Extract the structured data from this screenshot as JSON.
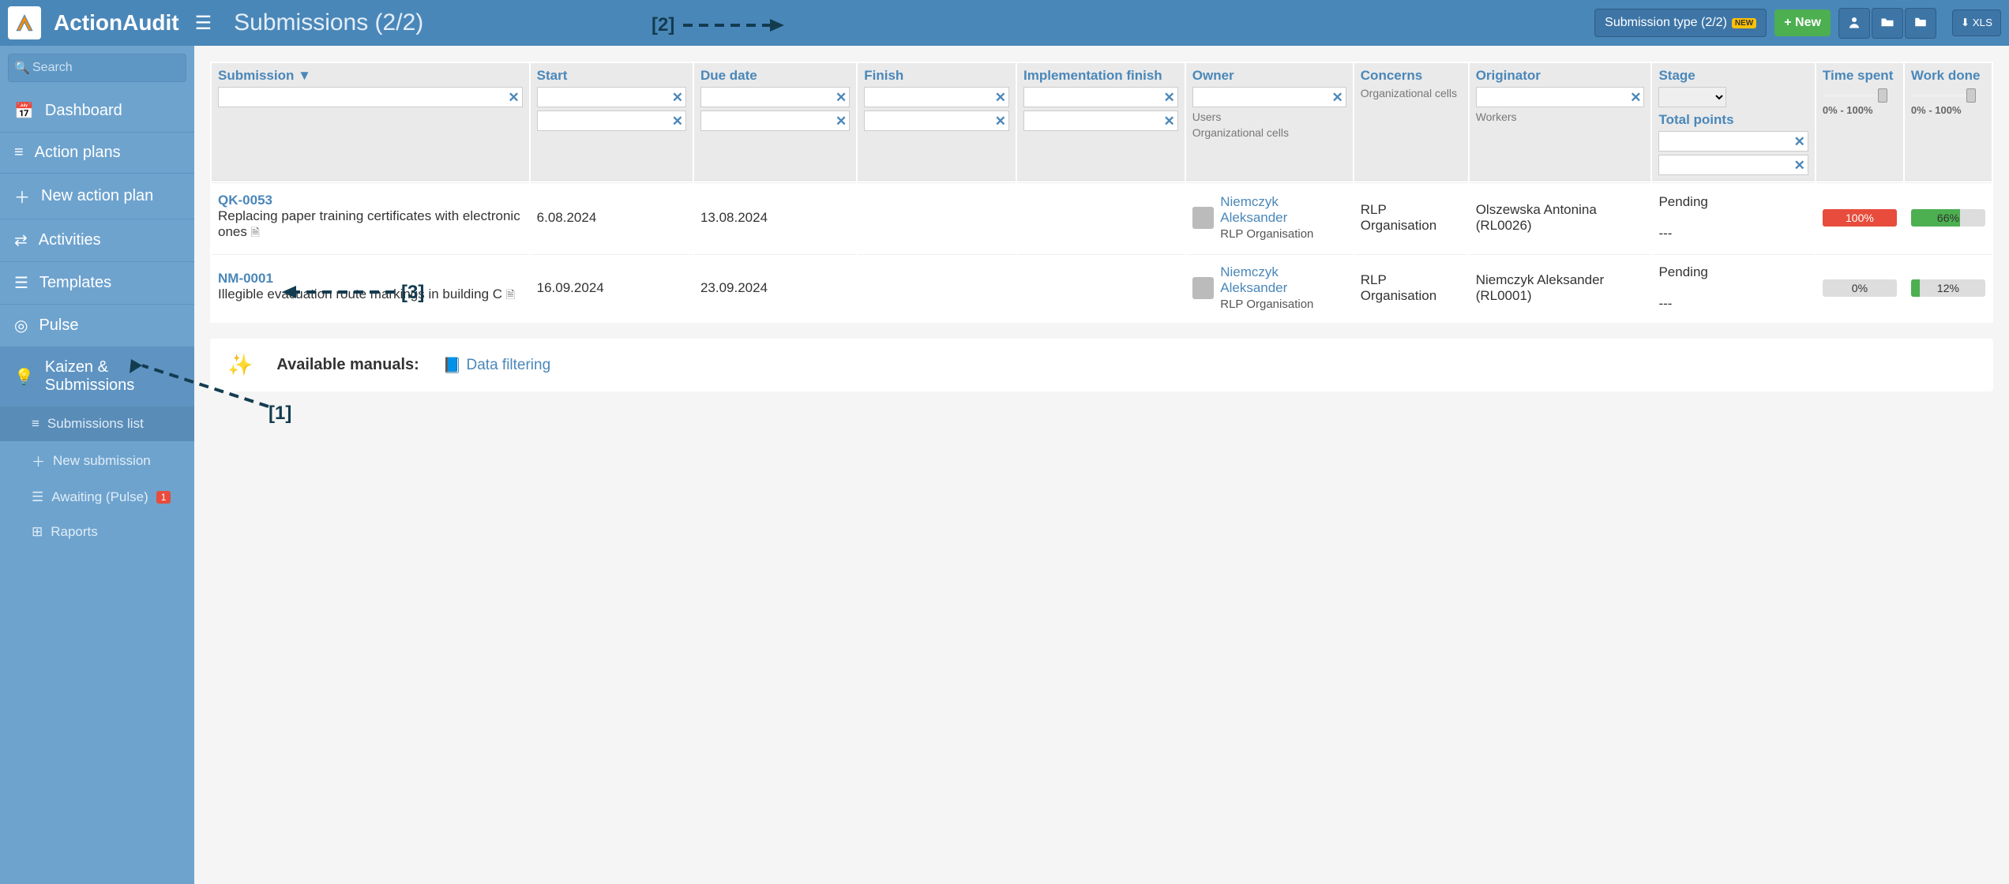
{
  "brand": "ActionAudit",
  "page_title": "Submissions (2/2)",
  "search_placeholder": "Search",
  "toolbar": {
    "submission_type": "Submission type (2/2)",
    "new_badge": "NEW",
    "new_btn": "+ New",
    "xls_btn": "XLS"
  },
  "sidebar": {
    "items": [
      {
        "icon": "calendar",
        "label": "Dashboard"
      },
      {
        "icon": "list",
        "label": "Action plans"
      },
      {
        "icon": "plus",
        "label": "New action plan"
      },
      {
        "icon": "sliders",
        "label": "Activities"
      },
      {
        "icon": "bars",
        "label": "Templates"
      },
      {
        "icon": "target",
        "label": "Pulse"
      },
      {
        "icon": "bulb",
        "label": "Kaizen & Submissions",
        "active": true
      }
    ],
    "subs": [
      {
        "icon": "list",
        "label": "Submissions list",
        "active": true
      },
      {
        "icon": "plus",
        "label": "New submission"
      },
      {
        "icon": "bars",
        "label": "Awaiting (Pulse)",
        "badge": "1"
      },
      {
        "icon": "grid",
        "label": "Raports"
      }
    ]
  },
  "columns": {
    "submission": "Submission ▼",
    "start": "Start",
    "due": "Due date",
    "finish": "Finish",
    "impl_finish": "Implementation finish",
    "owner": "Owner",
    "owner_sub1": "Users",
    "owner_sub2": "Organizational cells",
    "concerns": "Concerns",
    "concerns_sub": "Organizational cells",
    "originator": "Originator",
    "originator_sub": "Workers",
    "stage": "Stage",
    "total_points": "Total points",
    "time_spent": "Time spent",
    "work_done": "Work done",
    "pct_range": "0% - 100%"
  },
  "rows": [
    {
      "id": "QK-0053",
      "desc": "Replacing paper training certificates with electronic ones",
      "start": "6.08.2024",
      "due": "13.08.2024",
      "finish": "",
      "impl_finish": "",
      "owner_name": "Niemczyk Aleksander",
      "owner_org": "RLP Organisation",
      "concerns": "RLP Organisation",
      "originator": "Olszewska Antonina (RL0026)",
      "stage": "Pending",
      "total_points": "---",
      "time_spent": {
        "pct": 100,
        "label": "100%",
        "color": "red"
      },
      "work_done": {
        "pct": 66,
        "label": "66%",
        "color": "green"
      }
    },
    {
      "id": "NM-0001",
      "desc": "Illegible evacuation route markings in building C",
      "start": "16.09.2024",
      "due": "23.09.2024",
      "finish": "",
      "impl_finish": "",
      "owner_name": "Niemczyk Aleksander",
      "owner_org": "RLP Organisation",
      "concerns": "RLP Organisation",
      "originator": "Niemczyk Aleksander (RL0001)",
      "stage": "Pending",
      "total_points": "---",
      "time_spent": {
        "pct": 0,
        "label": "0%",
        "color": "none"
      },
      "work_done": {
        "pct": 12,
        "label": "12%",
        "color": "green"
      }
    }
  ],
  "manuals": {
    "title": "Available manuals:",
    "link": "Data filtering"
  },
  "annotations": {
    "a1": "[1]",
    "a2": "[2]",
    "a3": "[3]"
  }
}
